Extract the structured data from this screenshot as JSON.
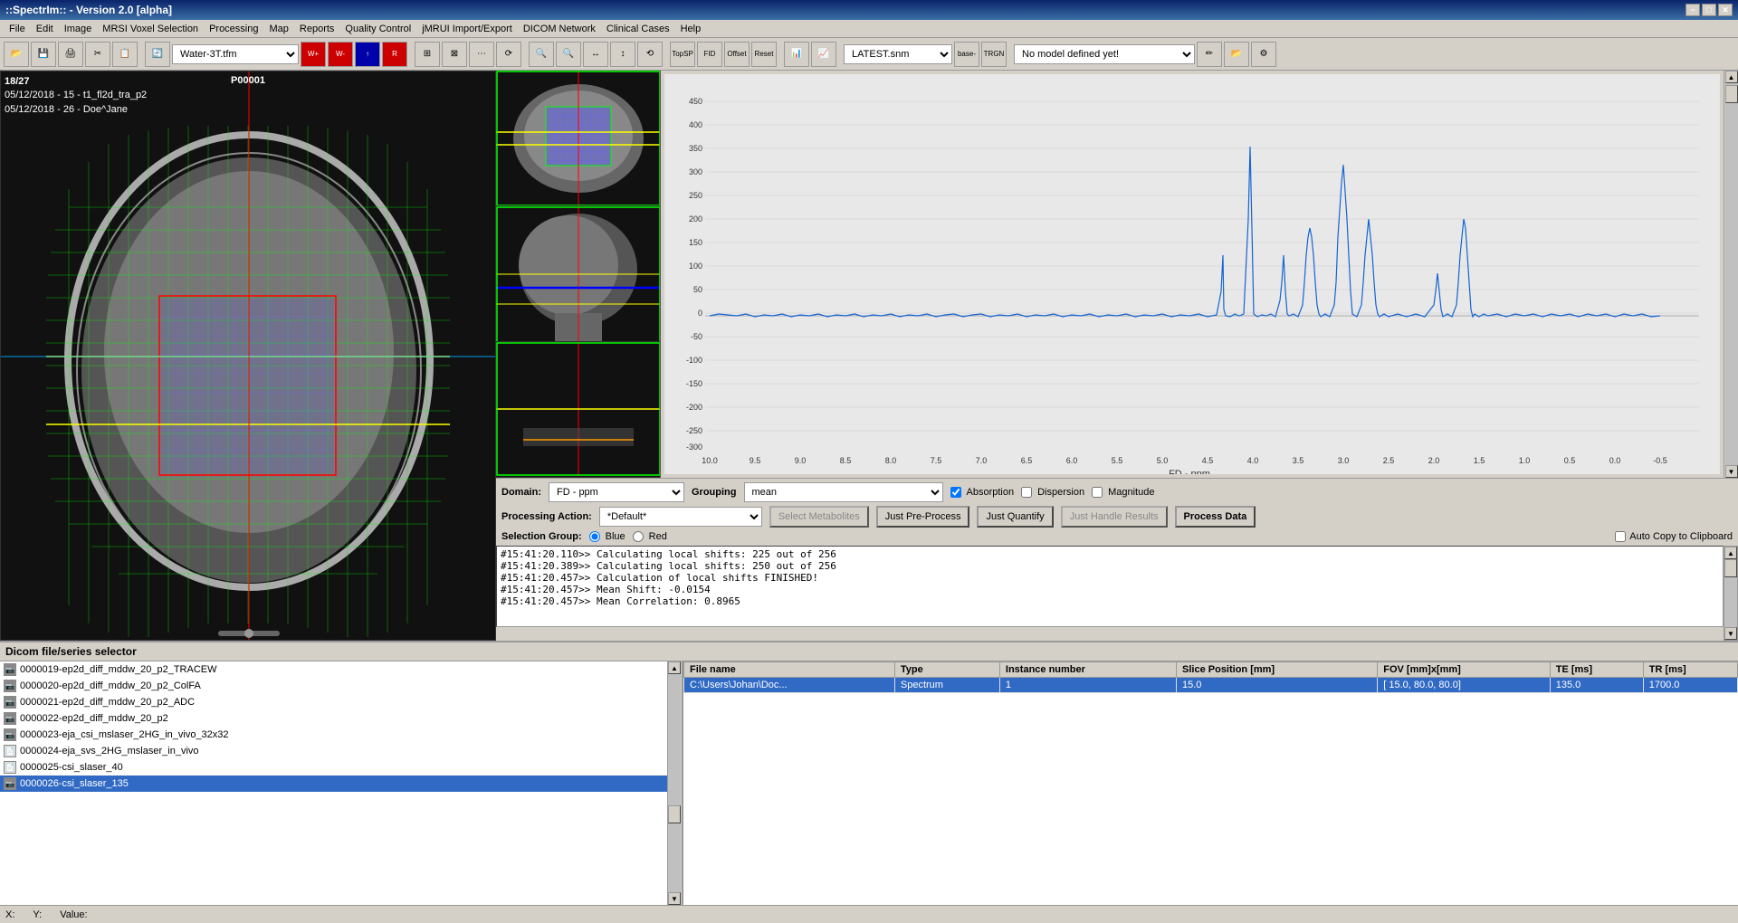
{
  "titlebar": {
    "title": "::SpectrIm:: - Version 2.0 [alpha]",
    "minimize": "−",
    "maximize": "□",
    "close": "✕"
  },
  "menubar": {
    "items": [
      "File",
      "Edit",
      "Image",
      "MRSI Voxel Selection",
      "Processing",
      "Map",
      "Reports",
      "Quality Control",
      "jMRUI Import/Export",
      "DICOM Network",
      "Clinical Cases",
      "Help"
    ]
  },
  "toolbar": {
    "water_filter_label": "Water-3T.tfm",
    "snm_label": "LATEST.snm",
    "model_label": "No model defined yet!"
  },
  "mri": {
    "slice_info": "18/27",
    "patient_id": "P00001",
    "date1": "05/12/2018 - 15 - t1_fl2d_tra_p2",
    "date2": "05/12/2018 - 26 - Doe^Jane"
  },
  "spectrum": {
    "y_axis": [
      "450",
      "400",
      "350",
      "300",
      "250",
      "200",
      "150",
      "100",
      "50",
      "0",
      "-50",
      "-100",
      "-150",
      "-200",
      "-250",
      "-300"
    ],
    "x_axis": [
      "10.0",
      "9.5",
      "9.0",
      "8.5",
      "8.0",
      "7.5",
      "7.0",
      "6.5",
      "6.0",
      "5.5",
      "5.0",
      "4.5",
      "4.0",
      "3.5",
      "3.0",
      "2.5",
      "2.0",
      "1.5",
      "1.0",
      "0.5",
      "0.0",
      "-0.5"
    ],
    "x_label": "FD - ppm"
  },
  "controls": {
    "domain_label": "Domain:",
    "domain_value": "FD - ppm",
    "grouping_label": "Grouping",
    "grouping_value": "mean",
    "absorption_label": "Absorption",
    "dispersion_label": "Dispersion",
    "magnitude_label": "Magnitude",
    "processing_action_label": "Processing Action:",
    "processing_action_value": "*Default*",
    "select_metabolites_label": "Select Metabolites",
    "just_preprocess_label": "Just Pre-Process",
    "just_quantify_label": "Just Quantify",
    "just_handle_results_label": "Just Handle Results",
    "process_data_label": "Process Data",
    "selection_group_label": "Selection Group:",
    "blue_label": "Blue",
    "red_label": "Red",
    "auto_copy_label": "Auto Copy to Clipboard"
  },
  "log": {
    "lines": [
      "#15:41:20.110>> Calculating local shifts: 225 out of 256",
      "#15:41:20.389>> Calculating local shifts: 250 out of 256",
      "#15:41:20.457>> Calculation of local shifts FINISHED!",
      "#15:41:20.457>> Mean Shift: -0.0154",
      "#15:41:20.457>> Mean Correlation: 0.8965"
    ]
  },
  "bottom": {
    "title": "Dicom file/series selector",
    "files": [
      {
        "icon": "img",
        "name": "0000019-ep2d_diff_mddw_20_p2_TRACEW"
      },
      {
        "icon": "img",
        "name": "0000020-ep2d_diff_mddw_20_p2_ColFA"
      },
      {
        "icon": "img",
        "name": "0000021-ep2d_diff_mddw_20_p2_ADC"
      },
      {
        "icon": "img",
        "name": "0000022-ep2d_diff_mddw_20_p2"
      },
      {
        "icon": "img",
        "name": "0000023-eja_csi_mslaser_2HG_in_vivo_32x32"
      },
      {
        "icon": "txt",
        "name": "0000024-eja_svs_2HG_mslaser_in_vivo"
      },
      {
        "icon": "txt",
        "name": "0000025-csi_slaser_40"
      },
      {
        "icon": "img",
        "name": "0000026-csi_slaser_135"
      }
    ],
    "selected_file_index": 7,
    "table_headers": [
      "File name",
      "Type",
      "Instance number",
      "Slice Position [mm]",
      "FOV [mm]x[mm]",
      "TE [ms]",
      "TR [ms]"
    ],
    "table_rows": [
      {
        "filename": "C:\\Users\\Johan\\Doc...",
        "type": "Spectrum",
        "instance": "1",
        "slice_pos": "15.0",
        "fov": "[ 15.0, 80.0, 80.0]",
        "te": "135.0",
        "tr": "1700.0",
        "selected": true
      }
    ]
  },
  "statusbar": {
    "x_label": "X:",
    "y_label": "Y:",
    "value_label": "Value:"
  }
}
